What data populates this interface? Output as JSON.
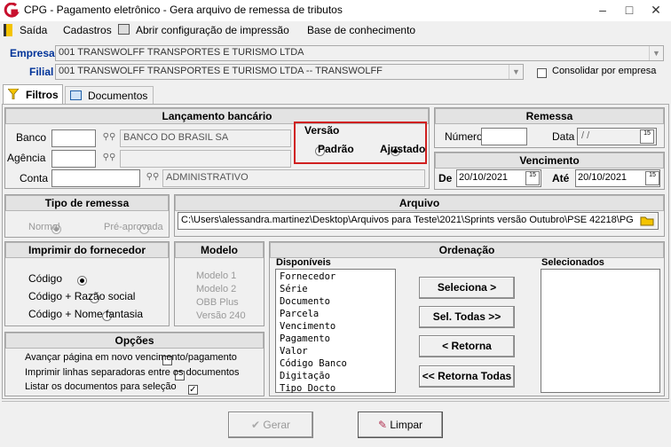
{
  "window": {
    "title": "CPG -  Pagamento eletrônico - Gera arquivo de remessa de tributos",
    "minimize": "–",
    "maximize": "□",
    "close": "✕"
  },
  "menu": {
    "saida": "Saída",
    "cadastros": "Cadastros",
    "abrir": "Abrir configuração de impressão",
    "base": "Base de conhecimento"
  },
  "empresa": {
    "label": "Empresa",
    "value": "001 TRANSWOLFF TRANSPORTES E TURISMO LTDA"
  },
  "filial": {
    "label": "Filial",
    "value": "001 TRANSWOLFF TRANSPORTES E TURISMO LTDA -- TRANSWOLFF",
    "consolidar": "Consolidar por empresa"
  },
  "tabs": {
    "filtros": "Filtros",
    "documentos": "Documentos"
  },
  "lanc": {
    "title": "Lançamento bancário",
    "banco_label": "Banco",
    "banco_value": "BANCO DO BRASIL SA",
    "agencia_label": "Agência",
    "conta_label": "Conta",
    "conta_value": "ADMINISTRATIVO"
  },
  "versao": {
    "title": "Versão",
    "padrao": "Padrão",
    "ajustado": "Ajustado"
  },
  "remessa": {
    "title": "Remessa",
    "numero": "Número",
    "data": "Data",
    "data_value": " / /"
  },
  "vencimento": {
    "title": "Vencimento",
    "de": "De",
    "de_value": "20/10/2021",
    "ate": "Até",
    "ate_value": "20/10/2021"
  },
  "tipo": {
    "title": "Tipo de remessa",
    "normal": "Normal",
    "pre": "Pré-aprovada"
  },
  "arquivo": {
    "title": "Arquivo",
    "path": "C:\\Users\\alessandra.martinez\\Desktop\\Arquivos para Teste\\2021\\Sprints versão Outubro\\PSE 42218\\PG"
  },
  "imprimir": {
    "title": "Imprimir do fornecedor",
    "codigo": "Código",
    "razao": "Código + Razão social",
    "fantasia": "Código + Nome fantasia"
  },
  "modelo": {
    "title": "Modelo",
    "m1": "Modelo 1",
    "m2": "Modelo 2",
    "obb": "OBB Plus",
    "v240": "Versão 240"
  },
  "opcoes": {
    "title": "Opções",
    "o1": "Avançar página em novo vencimento/pagamento",
    "o2": "Imprimir linhas separadoras entre os documentos",
    "o3": "Listar os documentos para seleção"
  },
  "ordenacao": {
    "title": "Ordenação",
    "disponiveis": "Disponíveis",
    "selecionados": "Selecionados",
    "items": [
      "Fornecedor",
      "Série",
      "Documento",
      "Parcela",
      "Vencimento",
      "Pagamento",
      "Valor",
      "Código Banco",
      "Digitação",
      "Tipo Docto"
    ],
    "seleciona": "Seleciona >",
    "sel_todas": "Sel. Todas >>",
    "retorna": "< Retorna",
    "retorna_todas": "<< Retorna Todas"
  },
  "footer": {
    "gerar": "Gerar",
    "limpar": "Limpar"
  }
}
